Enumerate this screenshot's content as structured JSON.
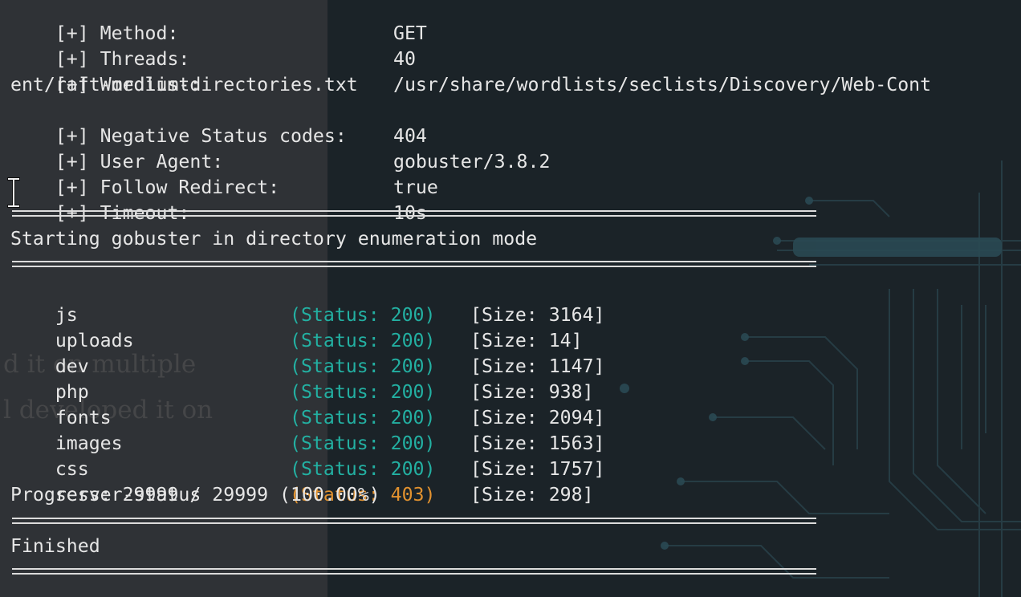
{
  "config": [
    {
      "key": "[+] Method:",
      "value": "GET"
    },
    {
      "key": "[+] Threads:",
      "value": "40"
    },
    {
      "key": "[+] Wordlist:",
      "value": "/usr/share/wordlists/seclists/Discovery/Web-Cont",
      "continuation": "ent/raft-medium-directories.txt"
    },
    {
      "key": "[+] Negative Status codes:",
      "value": "404"
    },
    {
      "key": "[+] User Agent:",
      "value": "gobuster/3.8.2"
    },
    {
      "key": "[+] Follow Redirect:",
      "value": "true"
    },
    {
      "key": "[+] Timeout:",
      "value": "10s"
    }
  ],
  "mode_message": "Starting gobuster in directory enumeration mode",
  "results": [
    {
      "path": "js",
      "status": "(Status: 200)",
      "size": "[Size: 3164]",
      "status_color": "#23b0a2"
    },
    {
      "path": "uploads",
      "status": "(Status: 200)",
      "size": "[Size: 14]",
      "status_color": "#23b0a2"
    },
    {
      "path": "dev",
      "status": "(Status: 200)",
      "size": "[Size: 1147]",
      "status_color": "#23b0a2"
    },
    {
      "path": "php",
      "status": "(Status: 200)",
      "size": "[Size: 938]",
      "status_color": "#23b0a2"
    },
    {
      "path": "fonts",
      "status": "(Status: 200)",
      "size": "[Size: 2094]",
      "status_color": "#23b0a2"
    },
    {
      "path": "images",
      "status": "(Status: 200)",
      "size": "[Size: 1563]",
      "status_color": "#23b0a2"
    },
    {
      "path": "css",
      "status": "(Status: 200)",
      "size": "[Size: 1757]",
      "status_color": "#23b0a2"
    },
    {
      "path": "server-status",
      "status": "(Status: 403)",
      "size": "[Size: 298]",
      "status_color": "#e2922f"
    }
  ],
  "progress": "Progress: 29999 / 29999 (100.00%)",
  "finished": "Finished",
  "background_text": [
    "d it on multiple",
    "l developed it on"
  ],
  "colors": {
    "text": "#e6e6e6",
    "status_ok": "#23b0a2",
    "status_forbidden": "#e2922f",
    "bg_left": "#2f3236",
    "bg_right": "#1b2328"
  },
  "icons": {
    "cursor": "text-cursor-icon"
  }
}
